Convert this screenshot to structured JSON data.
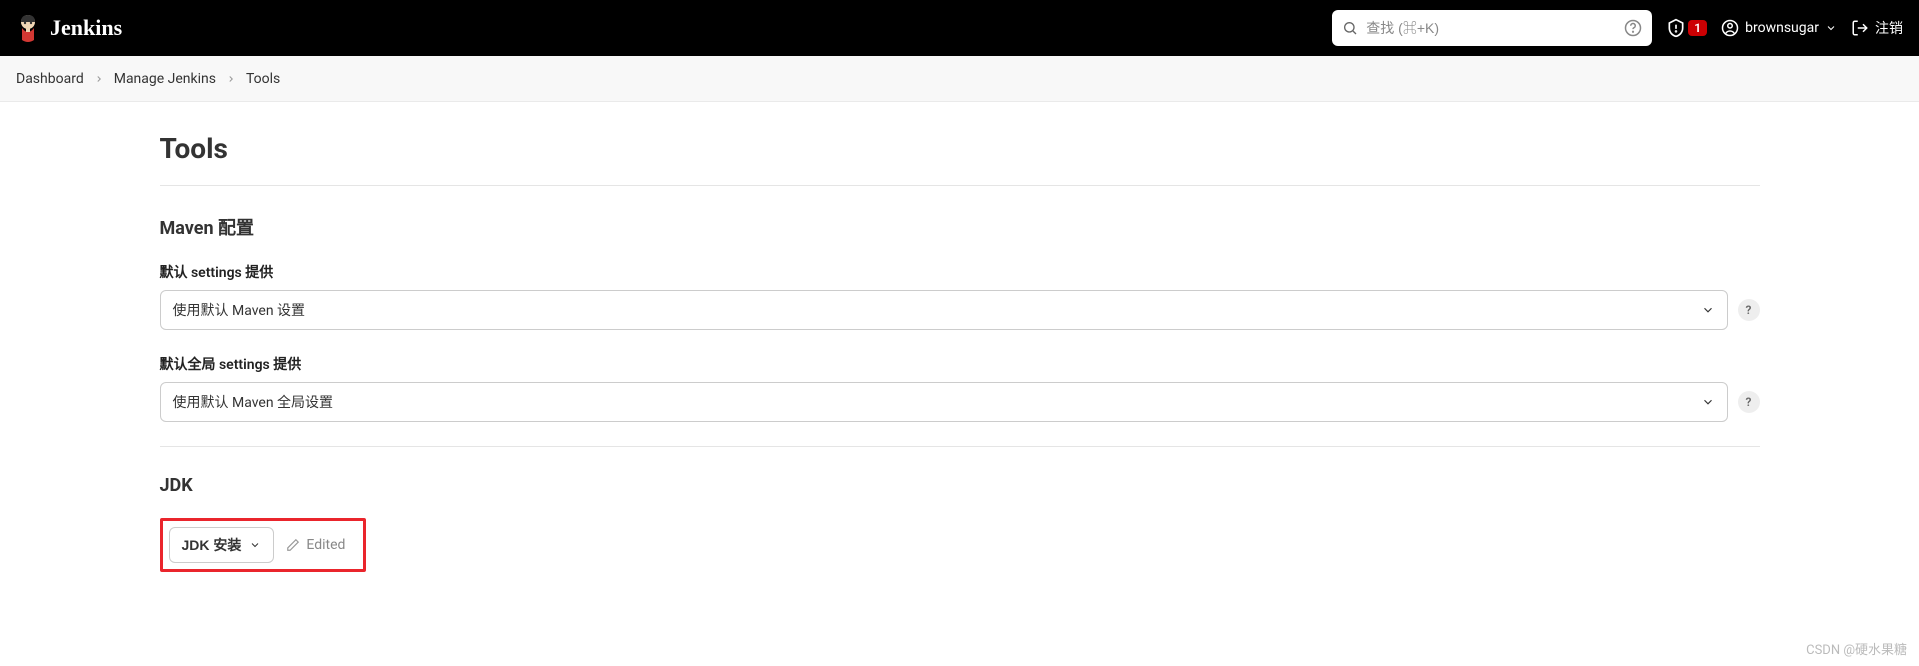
{
  "header": {
    "logo_text": "Jenkins",
    "search_placeholder": "查找 (⌘+K)",
    "alert_count": "1",
    "username": "brownsugar",
    "logout_label": "注销"
  },
  "breadcrumb": {
    "items": [
      "Dashboard",
      "Manage Jenkins",
      "Tools"
    ]
  },
  "page": {
    "title": "Tools"
  },
  "maven": {
    "section_title": "Maven 配置",
    "default_settings_label": "默认 settings 提供",
    "default_settings_value": "使用默认 Maven 设置",
    "global_settings_label": "默认全局 settings 提供",
    "global_settings_value": "使用默认 Maven 全局设置",
    "help_label": "?"
  },
  "jdk": {
    "section_title": "JDK",
    "install_button": "JDK 安装",
    "edited_label": "Edited"
  },
  "watermark": "CSDN @硬水果糖"
}
